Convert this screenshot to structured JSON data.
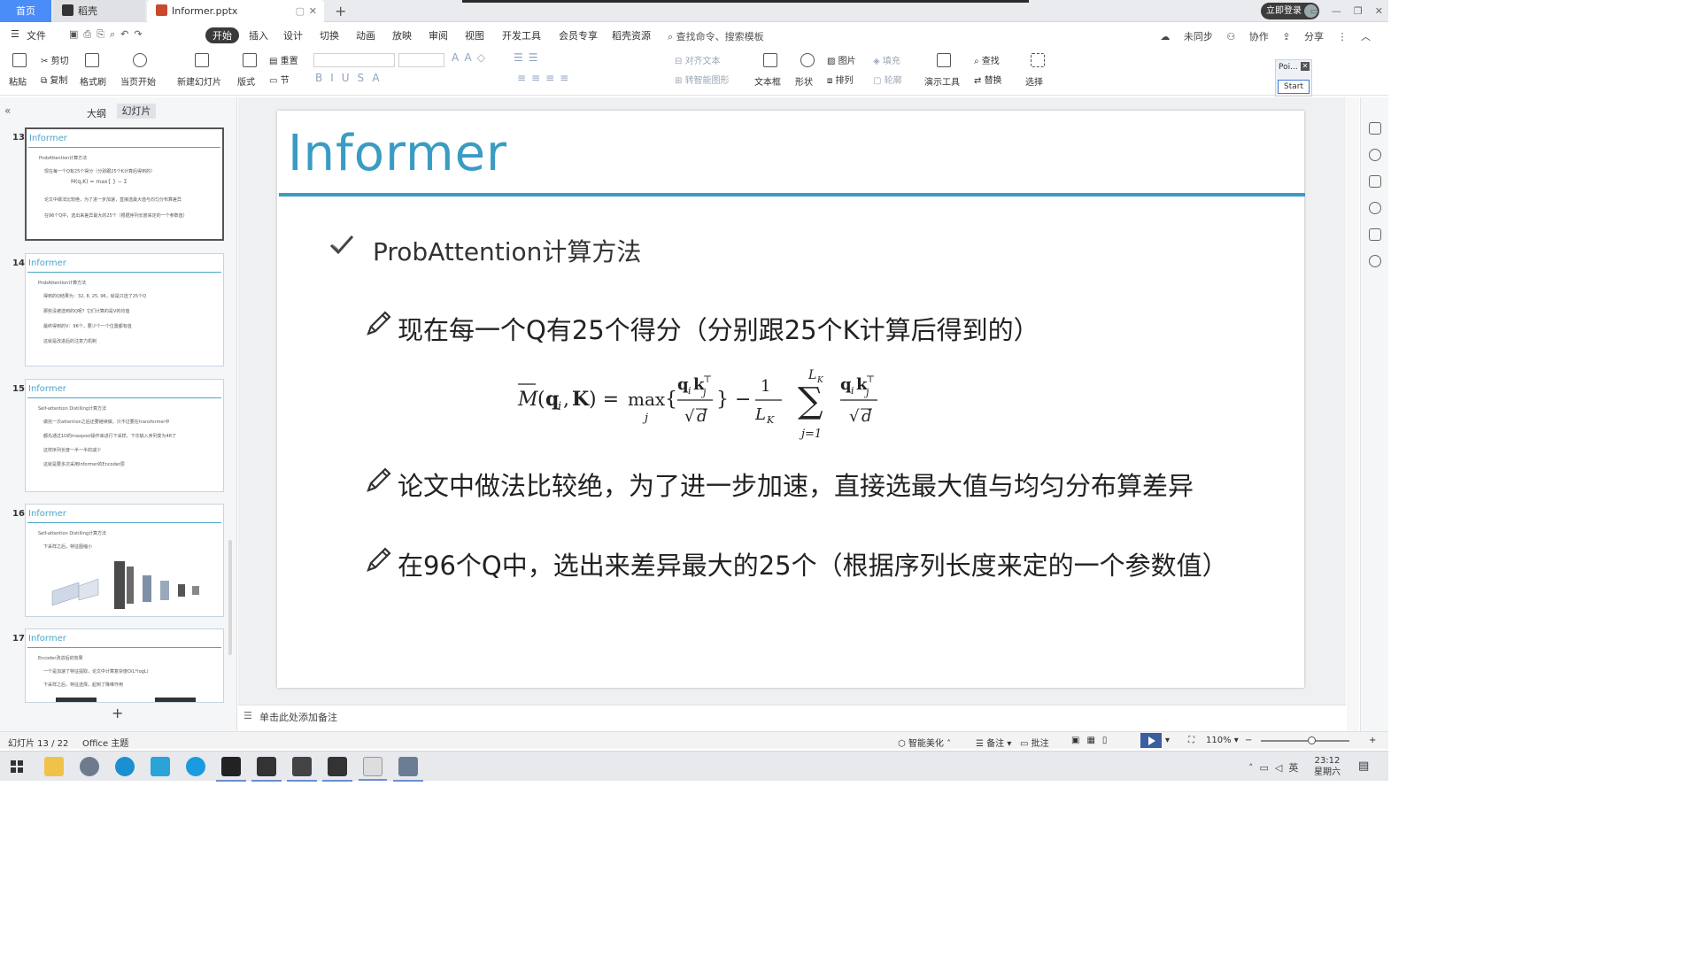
{
  "tabs": {
    "home": "首页",
    "daoke": "稻壳",
    "file": "Informer.pptx"
  },
  "window": {
    "login": "立即登录"
  },
  "menu": [
    "文件",
    "开始",
    "插入",
    "设计",
    "切换",
    "动画",
    "放映",
    "审阅",
    "视图",
    "开发工具",
    "会员专享",
    "稻壳资源"
  ],
  "search_cmd": "查找命令、搜索模板",
  "right_menu": {
    "sync": "未同步",
    "collab": "协作",
    "share": "分享"
  },
  "ribbon": {
    "paste": "粘贴",
    "cut": "剪切",
    "copy": "复制",
    "format_painter": "格式刷",
    "from_current": "当页开始",
    "new_slide": "新建幻灯片",
    "layout": "版式",
    "section": "节",
    "reset": "重置",
    "text_box": "文本框",
    "shape": "形状",
    "picture": "图片",
    "fill": "填充",
    "arrange": "排列",
    "outline": "轮廓",
    "present_tools": "演示工具",
    "find": "查找",
    "replace": "替换",
    "select": "选择",
    "align_text": "对齐文本",
    "smart_art": "转智能图形"
  },
  "popup": {
    "title": "Poi...",
    "start": "Start"
  },
  "left_pane": {
    "outline_tab": "大纲",
    "slides_tab": "幻灯片"
  },
  "thumbnails": [
    {
      "num": "13",
      "title": "Informer",
      "head": "ProbAttention计算方法",
      "lines": [
        "现在每一个Q有25个得分（分别跟25个K计算后得到的）",
        "论文中做法比较绝，为了进一步加速，直接选最大值与均匀分布算差异",
        "在96个Q中，选出来差异最大的25个（根据序列长度来定的一个参数值）"
      ]
    },
    {
      "num": "14",
      "title": "Informer",
      "head": "ProbAttention计算方法",
      "lines": [
        "得到的Q结果为：32, 8, 25, 96，就是只选了25个Q",
        "那些没被选到的Q呢？它们计算的是V的均值",
        "最终得到的V：96个，要少个一个位置都有值",
        "这就是改进后的注意力机制"
      ]
    },
    {
      "num": "15",
      "title": "Informer",
      "head": "Self-attention Distilling计算方法",
      "lines": [
        "做完一次attention之后还要继续做，只不过要在transformer中",
        "都先通过1D的maxpool操作来进行下采样，下次输入序列变为48了",
        "这样序列长度一半一半的减少",
        "这就是要多次采用Informer的Encoder层"
      ]
    },
    {
      "num": "16",
      "title": "Informer",
      "head": "Self-attention Distilling计算方法",
      "lines": [
        "下采样之后，特征图缩小"
      ]
    },
    {
      "num": "17",
      "title": "Informer",
      "head": "Encoder改进后的效果",
      "lines": [
        "一个是加速了特征提取，论文中计算复杂度O(L*logL)",
        "下采样之后，特征选择，起到了降维作用"
      ]
    }
  ],
  "slide": {
    "title": "Informer",
    "subtitle": "ProbAttention计算方法",
    "bullets": [
      "现在每一个Q有25个得分（分别跟25个K计算后得到的）",
      "论文中做法比较绝，为了进一步加速，直接选最大值与均匀分布算差异",
      "在96个Q中，选出来差异最大的25个（根据序列长度来定的一个参数值）"
    ]
  },
  "notes_placeholder": "单击此处添加备注",
  "status": {
    "slide_num": "幻灯片 13 / 22",
    "theme": "Office 主题",
    "beautify": "智能美化",
    "notes": "备注",
    "comments": "批注",
    "zoom": "110%"
  },
  "clock": {
    "time": "23:12",
    "day": "星期六"
  },
  "tray": {
    "lang": "英"
  },
  "colors": {
    "accent": "#3a9cc3",
    "tab_active": "#4a8df8"
  }
}
